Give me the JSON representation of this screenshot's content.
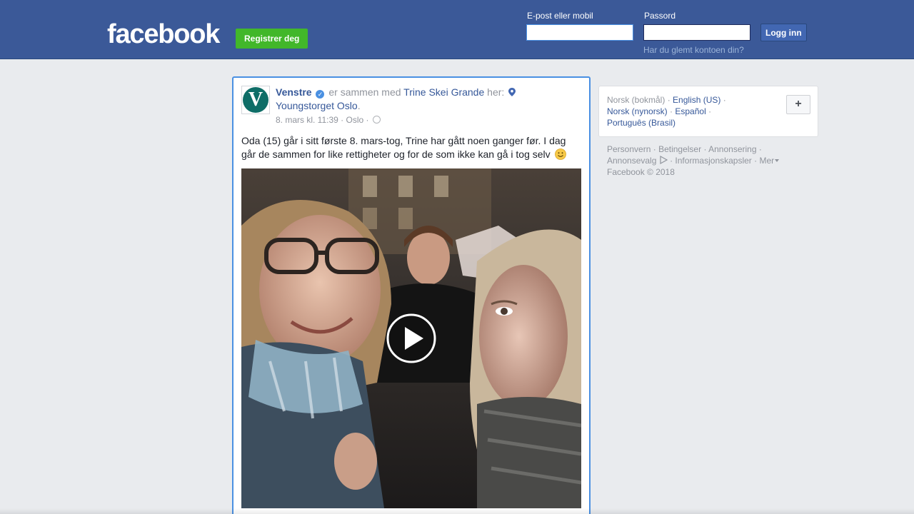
{
  "header": {
    "logo": "facebook",
    "register_label": "Registrer deg",
    "email_label": "E-post eller mobil",
    "email_value": "",
    "password_label": "Passord",
    "password_value": "",
    "login_label": "Logg inn",
    "forgot_label": "Har du glemt kontoen din?"
  },
  "post": {
    "author": "Venstre",
    "with_text": "er sammen med",
    "tagged_person": "Trine Skei Grande",
    "here_text": "her:",
    "location": "Youngstorget Oslo",
    "period": ".",
    "date": "8. mars kl. 11:39",
    "place": "Oslo",
    "meta_sep": "·",
    "text": "Oda (15) går i sitt første 8. mars-tog, Trine har gått noen ganger før. I dag går de sammen for like rettigheter og for de som ikke kan gå i tog selv",
    "avatar_letter": "V"
  },
  "languages": {
    "items": [
      {
        "label": "Norsk (bokmål)",
        "current": true
      },
      {
        "label": "English (US)",
        "current": false
      },
      {
        "label": "Norsk (nynorsk)",
        "current": false
      },
      {
        "label": "Español",
        "current": false
      },
      {
        "label": "Português (Brasil)",
        "current": false
      }
    ],
    "sep": "·",
    "add_label": "+"
  },
  "footer": {
    "privacy": "Personvern",
    "terms": "Betingelser",
    "advertising": "Annonsering",
    "ad_choices": "Annonsevalg",
    "cookies": "Informasjonskapsler",
    "more": "Mer",
    "copyright": "Facebook © 2018",
    "sep": "·"
  },
  "colors": {
    "brand": "#3b5998",
    "register_green": "#42b72a",
    "link": "#365899",
    "focus_border": "#4a90e2"
  }
}
